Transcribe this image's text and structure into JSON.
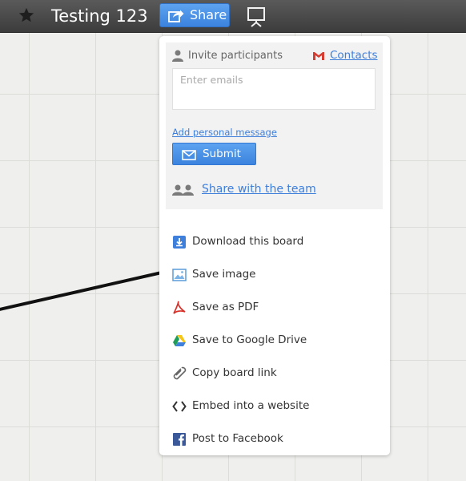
{
  "header": {
    "board_title": "Testing 123",
    "share_label": "Share"
  },
  "share_popup": {
    "invite_label": "Invite participants",
    "contacts_label": "Contacts",
    "email_placeholder": "Enter emails",
    "email_value": "",
    "add_message_label": "Add personal message",
    "submit_label": "Submit",
    "share_team_label": "Share with the team"
  },
  "menu": {
    "items": [
      {
        "label": "Download this board",
        "icon": "download-icon"
      },
      {
        "label": "Save image",
        "icon": "image-icon"
      },
      {
        "label": "Save as PDF",
        "icon": "pdf-icon"
      },
      {
        "label": "Save to Google Drive",
        "icon": "google-drive-icon"
      },
      {
        "label": "Copy board link",
        "icon": "link-icon"
      },
      {
        "label": "Embed into a website",
        "icon": "embed-icon"
      },
      {
        "label": "Post to Facebook",
        "icon": "facebook-icon"
      }
    ]
  },
  "colors": {
    "accent": "#3d7fdb",
    "topbar": "#444444",
    "canvas": "#efefed"
  }
}
